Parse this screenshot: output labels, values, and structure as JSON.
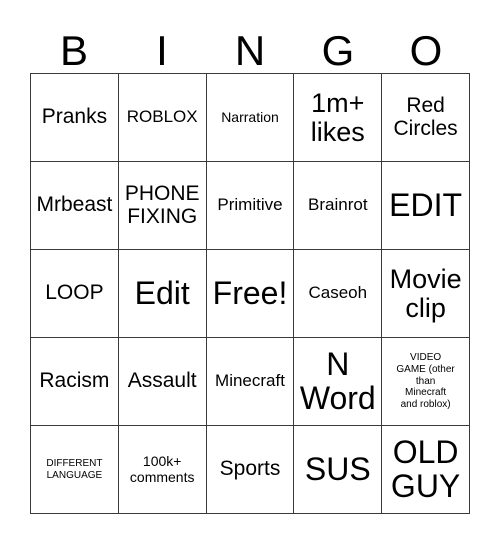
{
  "header": {
    "letters": [
      "B",
      "I",
      "N",
      "G",
      "O"
    ]
  },
  "grid": {
    "columns": 5,
    "rows": 5,
    "border_color": "#3a3a3a",
    "background_color": "#ffffff",
    "text_color": "#000000",
    "cells": [
      {
        "text": "Pranks",
        "size": "lg"
      },
      {
        "text": "ROBLOX",
        "size": "md"
      },
      {
        "text": "Narration",
        "size": "sm"
      },
      {
        "text": "1m+\nlikes",
        "size": "xl"
      },
      {
        "text": "Red\nCircles",
        "size": "lg"
      },
      {
        "text": "Mrbeast",
        "size": "lg"
      },
      {
        "text": "PHONE\nFIXING",
        "size": "lg"
      },
      {
        "text": "Primitive",
        "size": "md"
      },
      {
        "text": "Brainrot",
        "size": "md"
      },
      {
        "text": "EDIT",
        "size": "xxl"
      },
      {
        "text": "LOOP",
        "size": "lg"
      },
      {
        "text": "Edit",
        "size": "xxl"
      },
      {
        "text": "Free!",
        "size": "xxl"
      },
      {
        "text": "Caseoh",
        "size": "md"
      },
      {
        "text": "Movie\nclip",
        "size": "xl"
      },
      {
        "text": "Racism",
        "size": "lg"
      },
      {
        "text": "Assault",
        "size": "lg"
      },
      {
        "text": "Minecraft",
        "size": "md"
      },
      {
        "text": "N\nWord",
        "size": "xxl"
      },
      {
        "text": "VIDEO\nGAME (other\nthan\nMinecraft\nand roblox)",
        "size": "xs"
      },
      {
        "text": "DIFFERENT\nLANGUAGE",
        "size": "xs"
      },
      {
        "text": "100k+\ncomments",
        "size": "sm"
      },
      {
        "text": "Sports",
        "size": "lg"
      },
      {
        "text": "SUS",
        "size": "xxl"
      },
      {
        "text": "OLD\nGUY",
        "size": "xxl"
      }
    ]
  }
}
